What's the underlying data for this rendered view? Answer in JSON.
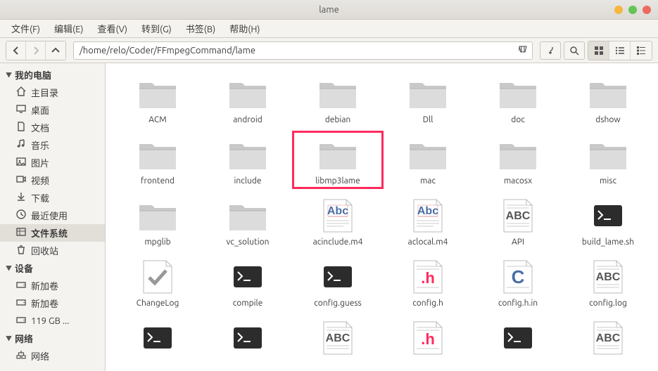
{
  "window": {
    "title": "lame"
  },
  "menu": {
    "file": "文件(F)",
    "edit": "编辑(E)",
    "view": "查看(V)",
    "go": "转到(G)",
    "bookmarks": "书签(B)",
    "help": "帮助(H)"
  },
  "toolbar": {
    "path": "/home/relo/Coder/FFmpegCommand/lame"
  },
  "sidebar": {
    "sections": [
      {
        "label": "我的电脑",
        "items": [
          {
            "icon": "home",
            "label": "主目录"
          },
          {
            "icon": "desktop",
            "label": "桌面"
          },
          {
            "icon": "document",
            "label": "文档"
          },
          {
            "icon": "music",
            "label": "音乐"
          },
          {
            "icon": "picture",
            "label": "图片"
          },
          {
            "icon": "video",
            "label": "视频"
          },
          {
            "icon": "download",
            "label": "下载"
          },
          {
            "icon": "recent",
            "label": "最近使用"
          },
          {
            "icon": "filesystem",
            "label": "文件系统",
            "selected": true
          },
          {
            "icon": "trash",
            "label": "回收站"
          }
        ]
      },
      {
        "label": "设备",
        "items": [
          {
            "icon": "drive",
            "label": "新加卷"
          },
          {
            "icon": "drive",
            "label": "新加卷"
          },
          {
            "icon": "drive",
            "label": "119 GB ..."
          }
        ]
      },
      {
        "label": "网络",
        "items": [
          {
            "icon": "network",
            "label": "网络"
          }
        ]
      }
    ]
  },
  "files": [
    {
      "name": "ACM",
      "type": "folder"
    },
    {
      "name": "android",
      "type": "folder"
    },
    {
      "name": "debian",
      "type": "folder"
    },
    {
      "name": "Dll",
      "type": "folder"
    },
    {
      "name": "doc",
      "type": "folder"
    },
    {
      "name": "dshow",
      "type": "folder"
    },
    {
      "name": "frontend",
      "type": "folder"
    },
    {
      "name": "include",
      "type": "folder"
    },
    {
      "name": "libmp3lame",
      "type": "folder",
      "highlighted": true
    },
    {
      "name": "mac",
      "type": "folder"
    },
    {
      "name": "macosx",
      "type": "folder"
    },
    {
      "name": "misc",
      "type": "folder"
    },
    {
      "name": "mpglib",
      "type": "folder"
    },
    {
      "name": "vc_solution",
      "type": "folder"
    },
    {
      "name": "acinclude.m4",
      "type": "abc"
    },
    {
      "name": "aclocal.m4",
      "type": "abc"
    },
    {
      "name": "API",
      "type": "bigabc"
    },
    {
      "name": "build_lame.sh",
      "type": "shell"
    },
    {
      "name": "ChangeLog",
      "type": "check"
    },
    {
      "name": "compile",
      "type": "shell"
    },
    {
      "name": "config.guess",
      "type": "shell"
    },
    {
      "name": "config.h",
      "type": "h"
    },
    {
      "name": "config.h.in",
      "type": "c"
    },
    {
      "name": "config.log",
      "type": "bigabc"
    },
    {
      "name": "",
      "type": "shell"
    },
    {
      "name": "",
      "type": "shell"
    },
    {
      "name": "",
      "type": "bigabc"
    },
    {
      "name": "",
      "type": "h"
    },
    {
      "name": "",
      "type": "shell"
    },
    {
      "name": "",
      "type": "bigabc"
    }
  ]
}
